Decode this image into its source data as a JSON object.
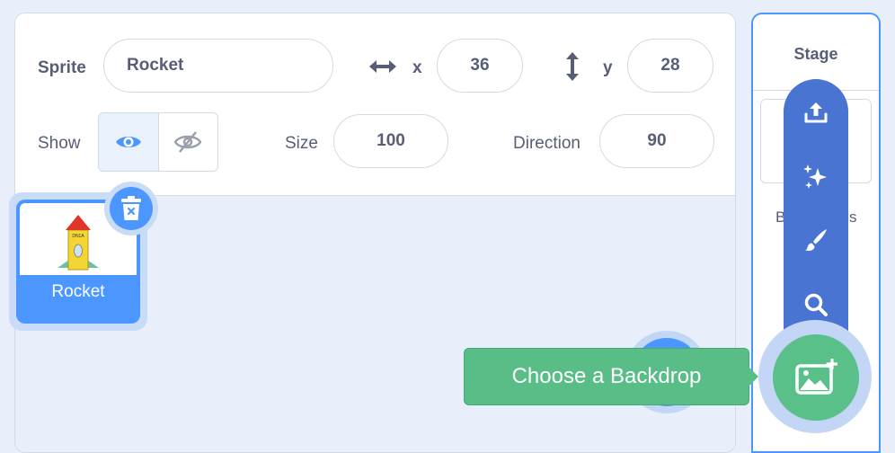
{
  "sprite_info": {
    "sprite_label": "Sprite",
    "sprite_name": "Rocket",
    "x_label": "x",
    "x_value": "36",
    "y_label": "y",
    "y_value": "28",
    "show_label": "Show",
    "size_label": "Size",
    "size_value": "100",
    "direction_label": "Direction",
    "direction_value": "90"
  },
  "sprite_list": {
    "sprites": [
      {
        "name": "Rocket",
        "thumbnail_text": "DN1A",
        "selected": true
      }
    ]
  },
  "stage": {
    "title": "Stage",
    "backdrops_label_visible_start": "B",
    "backdrops_label_visible_end": "s"
  },
  "backdrop_menu": {
    "items": [
      "upload-icon",
      "surprise-icon",
      "paint-icon",
      "search-icon"
    ],
    "main_button_icon": "choose-backdrop-icon",
    "tooltip": "Choose a Backdrop"
  },
  "colors": {
    "accent_blue": "#4c97ff",
    "menu_blue": "#4a74d1",
    "action_green": "#59c08a",
    "text_gray": "#575e75"
  }
}
